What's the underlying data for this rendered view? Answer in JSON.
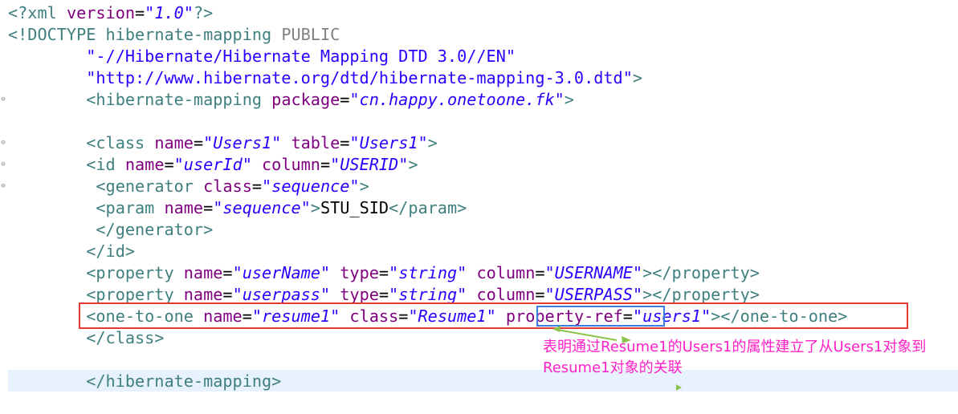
{
  "code_lines": [
    [
      {
        "t": "pi",
        "v": "<?xml "
      },
      {
        "t": "attr",
        "v": "version"
      },
      {
        "t": "plain",
        "v": "="
      },
      {
        "t": "val",
        "v": "\"1.0\""
      },
      {
        "t": "pi",
        "v": "?>"
      }
    ],
    [
      {
        "t": "tag",
        "v": "<!DOCTYPE "
      },
      {
        "t": "tag",
        "v": "hibernate-mapping "
      },
      {
        "t": "doctype-kw",
        "v": "PUBLIC"
      }
    ],
    [
      {
        "t": "plain",
        "v": "        "
      },
      {
        "t": "str",
        "v": "\"-//Hibernate/Hibernate Mapping DTD 3.0//EN\""
      }
    ],
    [
      {
        "t": "plain",
        "v": "        "
      },
      {
        "t": "str",
        "v": "\"http://www.hibernate.org/dtd/hibernate-mapping-3.0.dtd\""
      },
      {
        "t": "tag",
        "v": ">"
      }
    ],
    [
      {
        "t": "plain",
        "v": "        "
      },
      {
        "t": "tag",
        "v": "<hibernate-mapping "
      },
      {
        "t": "attr",
        "v": "package"
      },
      {
        "t": "plain",
        "v": "="
      },
      {
        "t": "val",
        "v": "\"cn.happy.onetoone.fk\""
      },
      {
        "t": "tag",
        "v": ">"
      }
    ],
    [],
    [
      {
        "t": "plain",
        "v": "        "
      },
      {
        "t": "tag",
        "v": "<class "
      },
      {
        "t": "attr",
        "v": "name"
      },
      {
        "t": "plain",
        "v": "="
      },
      {
        "t": "val",
        "v": "\"Users1\""
      },
      {
        "t": "plain",
        "v": " "
      },
      {
        "t": "attr",
        "v": "table"
      },
      {
        "t": "plain",
        "v": "="
      },
      {
        "t": "val",
        "v": "\"Users1\""
      },
      {
        "t": "tag",
        "v": ">"
      }
    ],
    [
      {
        "t": "plain",
        "v": "        "
      },
      {
        "t": "tag",
        "v": "<id "
      },
      {
        "t": "attr",
        "v": "name"
      },
      {
        "t": "plain",
        "v": "="
      },
      {
        "t": "val",
        "v": "\"userId\""
      },
      {
        "t": "plain",
        "v": " "
      },
      {
        "t": "attr",
        "v": "column"
      },
      {
        "t": "plain",
        "v": "="
      },
      {
        "t": "val",
        "v": "\"USERID\""
      },
      {
        "t": "tag",
        "v": ">"
      }
    ],
    [
      {
        "t": "plain",
        "v": "         "
      },
      {
        "t": "tag",
        "v": "<generator "
      },
      {
        "t": "attr",
        "v": "class"
      },
      {
        "t": "plain",
        "v": "="
      },
      {
        "t": "val",
        "v": "\"sequence\""
      },
      {
        "t": "tag",
        "v": ">"
      }
    ],
    [
      {
        "t": "plain",
        "v": "         "
      },
      {
        "t": "tag",
        "v": "<param "
      },
      {
        "t": "attr",
        "v": "name"
      },
      {
        "t": "plain",
        "v": "="
      },
      {
        "t": "val",
        "v": "\"sequence\""
      },
      {
        "t": "tag",
        "v": ">"
      },
      {
        "t": "plain",
        "v": "STU_SID"
      },
      {
        "t": "tag",
        "v": "</param>"
      }
    ],
    [
      {
        "t": "plain",
        "v": "         "
      },
      {
        "t": "tag",
        "v": "</generator>"
      }
    ],
    [
      {
        "t": "plain",
        "v": "        "
      },
      {
        "t": "tag",
        "v": "</id>"
      }
    ],
    [
      {
        "t": "plain",
        "v": "        "
      },
      {
        "t": "tag",
        "v": "<property "
      },
      {
        "t": "attr",
        "v": "name"
      },
      {
        "t": "plain",
        "v": "="
      },
      {
        "t": "val",
        "v": "\"userName\""
      },
      {
        "t": "plain",
        "v": " "
      },
      {
        "t": "attr",
        "v": "type"
      },
      {
        "t": "plain",
        "v": "="
      },
      {
        "t": "val",
        "v": "\"string\""
      },
      {
        "t": "plain",
        "v": " "
      },
      {
        "t": "attr",
        "v": "column"
      },
      {
        "t": "plain",
        "v": "="
      },
      {
        "t": "val",
        "v": "\"USERNAME\""
      },
      {
        "t": "tag",
        "v": "></property>"
      }
    ],
    [
      {
        "t": "plain",
        "v": "        "
      },
      {
        "t": "tag",
        "v": "<property "
      },
      {
        "t": "attr",
        "v": "name"
      },
      {
        "t": "plain",
        "v": "="
      },
      {
        "t": "val",
        "v": "\"userpass\""
      },
      {
        "t": "plain",
        "v": " "
      },
      {
        "t": "attr",
        "v": "type"
      },
      {
        "t": "plain",
        "v": "="
      },
      {
        "t": "val",
        "v": "\"string\""
      },
      {
        "t": "plain",
        "v": " "
      },
      {
        "t": "attr",
        "v": "column"
      },
      {
        "t": "plain",
        "v": "="
      },
      {
        "t": "val",
        "v": "\"USERPASS\""
      },
      {
        "t": "tag",
        "v": "></property>"
      }
    ],
    [
      {
        "t": "plain",
        "v": "        "
      },
      {
        "t": "tag",
        "v": "<one-to-one "
      },
      {
        "t": "attr",
        "v": "name"
      },
      {
        "t": "plain",
        "v": "="
      },
      {
        "t": "val",
        "v": "\"resume1\""
      },
      {
        "t": "plain",
        "v": " "
      },
      {
        "t": "attr",
        "v": "class"
      },
      {
        "t": "plain",
        "v": "="
      },
      {
        "t": "val",
        "v": "\"Resume1\""
      },
      {
        "t": "plain",
        "v": " "
      },
      {
        "t": "attr",
        "v": "property-ref"
      },
      {
        "t": "plain",
        "v": "="
      },
      {
        "t": "val",
        "v": "\"users1\""
      },
      {
        "t": "tag",
        "v": "></one-to-one>"
      }
    ],
    [
      {
        "t": "plain",
        "v": "        "
      },
      {
        "t": "tag",
        "v": "</class>"
      }
    ],
    [],
    [
      {
        "t": "plain",
        "v": "        "
      },
      {
        "t": "tag",
        "v": "</hibernate-mapping>"
      }
    ]
  ],
  "annotation": {
    "text": "表明通过Resume1的Users1的属性建立了从Users1对象到Resume1对象的关联"
  },
  "fold_lines": [
    4,
    6,
    7,
    8
  ],
  "current_line_index": 17,
  "colors": {
    "red_box": "#e53935",
    "blue_box": "#3b7ddd",
    "annotation_text": "#ff20c8",
    "arrow": "#8bc34a"
  }
}
